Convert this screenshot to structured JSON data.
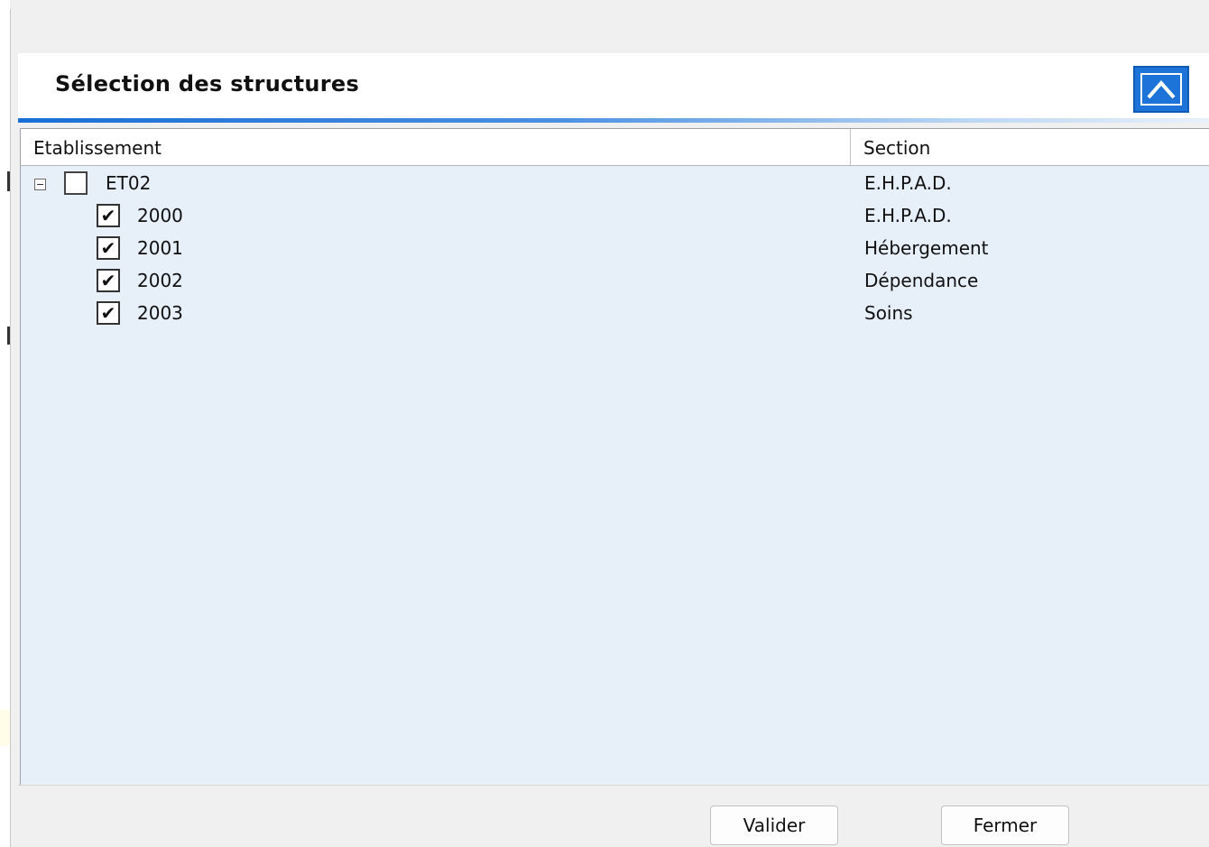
{
  "dialog": {
    "title": "Sélection des structures",
    "collapse_icon": "chevron-up-icon",
    "accent_color": "#1a6ed6"
  },
  "grid": {
    "columns": [
      "Etablissement",
      "Section"
    ],
    "rows": [
      {
        "label": "ET02",
        "section": "E.H.P.A.D.",
        "level": 0,
        "expanded": true,
        "checked": false
      },
      {
        "label": "2000",
        "section": "E.H.P.A.D.",
        "level": 1,
        "checked": true
      },
      {
        "label": "2001",
        "section": "Hébergement",
        "level": 1,
        "checked": true
      },
      {
        "label": "2002",
        "section": "Dépendance",
        "level": 1,
        "checked": true
      },
      {
        "label": "2003",
        "section": "Soins",
        "level": 1,
        "checked": true
      }
    ]
  },
  "footer": {
    "validate_label": "Valider",
    "close_label": "Fermer"
  }
}
